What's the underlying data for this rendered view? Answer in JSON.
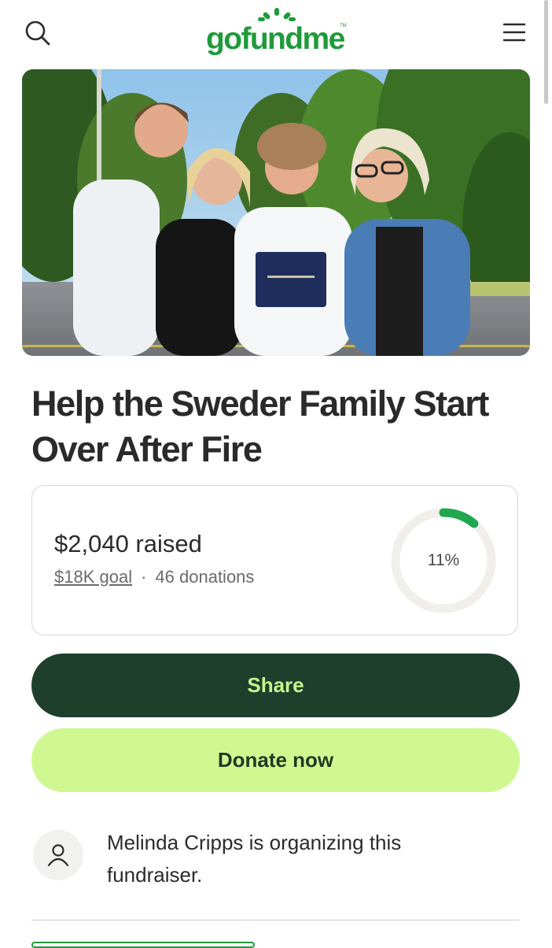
{
  "header": {
    "logo_text": "gofundme",
    "logo_tm": "TM",
    "brand_color": "#1f9a3a",
    "search_icon": "search-icon",
    "menu_icon": "hamburger-menu-icon"
  },
  "hero": {
    "image": "family-photo"
  },
  "campaign": {
    "title": "Help the Sweder Family Start Over After Fire",
    "raised_text": "$2,040 raised",
    "goal_text": "$18K goal",
    "separator": "·",
    "donations_text": "46 donations",
    "progress_percent": 11,
    "progress_label": "11%"
  },
  "actions": {
    "share_label": "Share",
    "donate_label": "Donate now"
  },
  "organizer": {
    "text": "Melinda Cripps is organizing this fundraiser.",
    "avatar_icon": "user-icon"
  },
  "colors": {
    "share_bg": "#1f3f2d",
    "share_text": "#c6f48e",
    "donate_bg": "#cff990",
    "progress": "#1fa84f"
  }
}
